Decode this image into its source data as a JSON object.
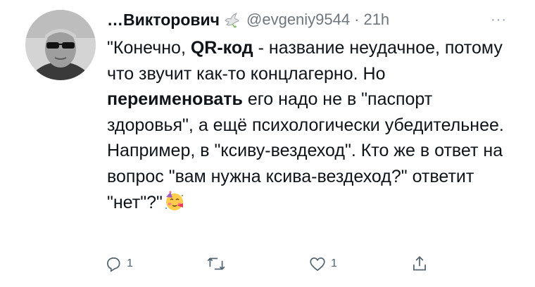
{
  "tweet": {
    "display_name": "…Викторович",
    "handle": "@evgeniy9544",
    "separator": "·",
    "time": "21h",
    "more_label": "···",
    "body": {
      "p1": "\"Конечно, ",
      "b1": "QR-код",
      "p2": " - название неудачное, потому что звучит как-то концлагерно. Но ",
      "b2": "переименовать",
      "p3": " его надо не в \"паспорт здоровья\", а ещё психологически убедительнее. Например, в \"ксиву-вездеход\". Кто же в ответ на вопрос \"вам нужна ксива-вездеход?\" ответит \"нет\"?\""
    },
    "emoji": "partying-face",
    "actions": {
      "reply_count": "1",
      "retweet_count": "",
      "like_count": "1"
    }
  },
  "icons": {
    "name_badge": "dove-icon",
    "reply": "reply-icon",
    "retweet": "retweet-icon",
    "like": "heart-icon",
    "share": "share-icon"
  },
  "colors": {
    "text": "#0f1419",
    "secondary": "#6e767d",
    "action_gray": "#536471"
  }
}
